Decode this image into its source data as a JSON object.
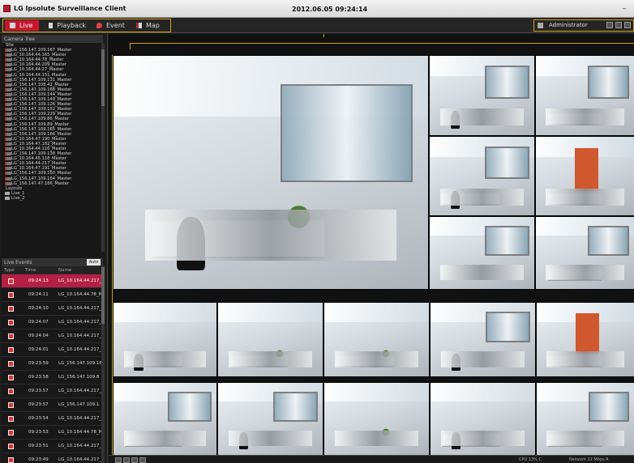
{
  "window": {
    "title": "LG Ipsolute Surveillance Client",
    "datetime": "2012.06.05 09:24:14",
    "minimize_symbol": "_"
  },
  "menu": {
    "tabs": [
      {
        "label": "Live",
        "icon": "camera-icon",
        "active": true
      },
      {
        "label": "Playback",
        "icon": "playback-icon",
        "active": false
      },
      {
        "label": "Event",
        "icon": "event-icon",
        "active": false
      },
      {
        "label": "Map",
        "icon": "map-icon",
        "active": false
      }
    ],
    "user": "Administrator"
  },
  "sidebar": {
    "camera_tree_title": "Camera Tree",
    "site_label": "Site",
    "cameras": [
      "LG_156.147.109.167_Master",
      "LG_10.164.44.165_Master",
      "LG_10.164.44.78_Master",
      "LG_10.164.44.209_Master",
      "LG_10.164.44.27_Master",
      "LG_10.164.44.151_Master",
      "LG_156.147.109.131_Master",
      "LG_156.147.108.42_Master",
      "LG_156.147.109.168_Master",
      "LG_156.147.109.144_Master",
      "LG_156.147.109.149_Master",
      "LG_156.147.109.126_Master",
      "LG_156.147.109.152_Master",
      "LG_156.147.109.229_Master",
      "LG_156.147.109.86_Master",
      "LG_156.147.109.89_Master",
      "LG_156.147.109.165_Master",
      "LG_156.147.109.166_Master",
      "LG_10.164.47.190_Master",
      "LG_10.164.47.182_Master",
      "LG_10.164.44.116_Master",
      "LG_156.147.109.138_Master",
      "LG_10.164.45.118_Master",
      "LG_10.164.44.217_Master",
      "LG_10.164.47.191_Master",
      "LG_156.147.109.150_Master",
      "LG_156.147.109.164_Master",
      "LG_156.147.47.186_Master"
    ],
    "layouts_label": "Layouts",
    "layouts": [
      "Live_1",
      "Live_2"
    ]
  },
  "live_events": {
    "title": "Live Events",
    "auto_label": "Auto",
    "columns": [
      "Type",
      "Time",
      "Name"
    ],
    "rows": [
      {
        "time": "09:24:13",
        "name": "LG_10.164.44.217_",
        "selected": true
      },
      {
        "time": "09:24:11",
        "name": "LG_10.164.44.78_M",
        "selected": false
      },
      {
        "time": "09:24:10",
        "name": "LG_10.164.44.217_",
        "selected": false
      },
      {
        "time": "09:24:07",
        "name": "LG_10.164.44.217_",
        "selected": false
      },
      {
        "time": "09:24:04",
        "name": "LG_10.164.44.217_",
        "selected": false
      },
      {
        "time": "09:24:01",
        "name": "LG_10.164.44.217_",
        "selected": false
      },
      {
        "time": "09:23:59",
        "name": "LG_156.147.109.16",
        "selected": false
      },
      {
        "time": "09:23:58",
        "name": "LG_156.147.109.8",
        "selected": false
      },
      {
        "time": "09:23:57",
        "name": "LG_10.164.44.217_",
        "selected": false
      },
      {
        "time": "09:23:57",
        "name": "LG_156.147.109.1",
        "selected": false
      },
      {
        "time": "09:23:54",
        "name": "LG_10.164.44.217_",
        "selected": false
      },
      {
        "time": "09:23:53",
        "name": "LG_10.164.44.78_M",
        "selected": false
      },
      {
        "time": "09:23:51",
        "name": "LG_10.164.44.217_",
        "selected": false
      },
      {
        "time": "09:23:49",
        "name": "LG_10.164.44.217_",
        "selected": false
      }
    ]
  },
  "status": {
    "cpu": "CPU 13% C",
    "network": "Network 12 Mbps R"
  }
}
